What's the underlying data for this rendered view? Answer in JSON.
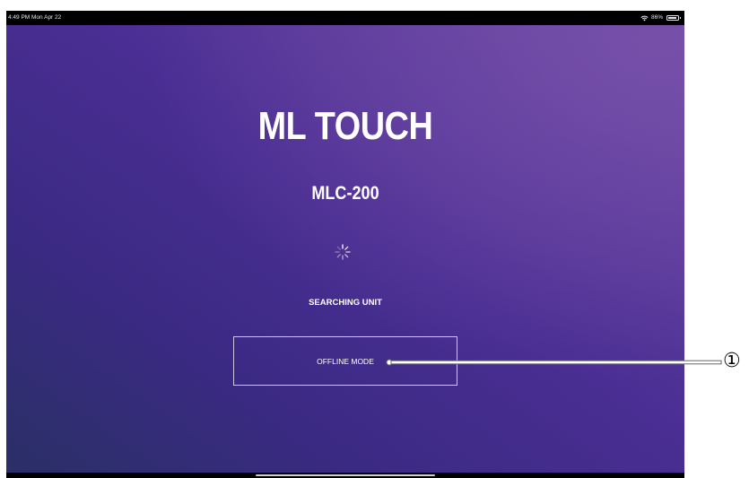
{
  "status_bar": {
    "time": "4:49 PM  Mon Apr 22",
    "battery": "86%",
    "icons": [
      "wifi-icon",
      "battery-icon"
    ]
  },
  "app": {
    "title": "ML TOUCH",
    "model": "MLC-200",
    "status_message": "SEARCHING UNIT",
    "spinner_icon": "loading-spinner-icon",
    "offline_button_label": "OFFLINE MODE"
  },
  "callout": {
    "number": "①"
  },
  "colors": {
    "background_dark": "#2a2f66",
    "background_mid": "#4a2e93",
    "background_light": "#6a4ea2",
    "text": "#ffffff"
  }
}
